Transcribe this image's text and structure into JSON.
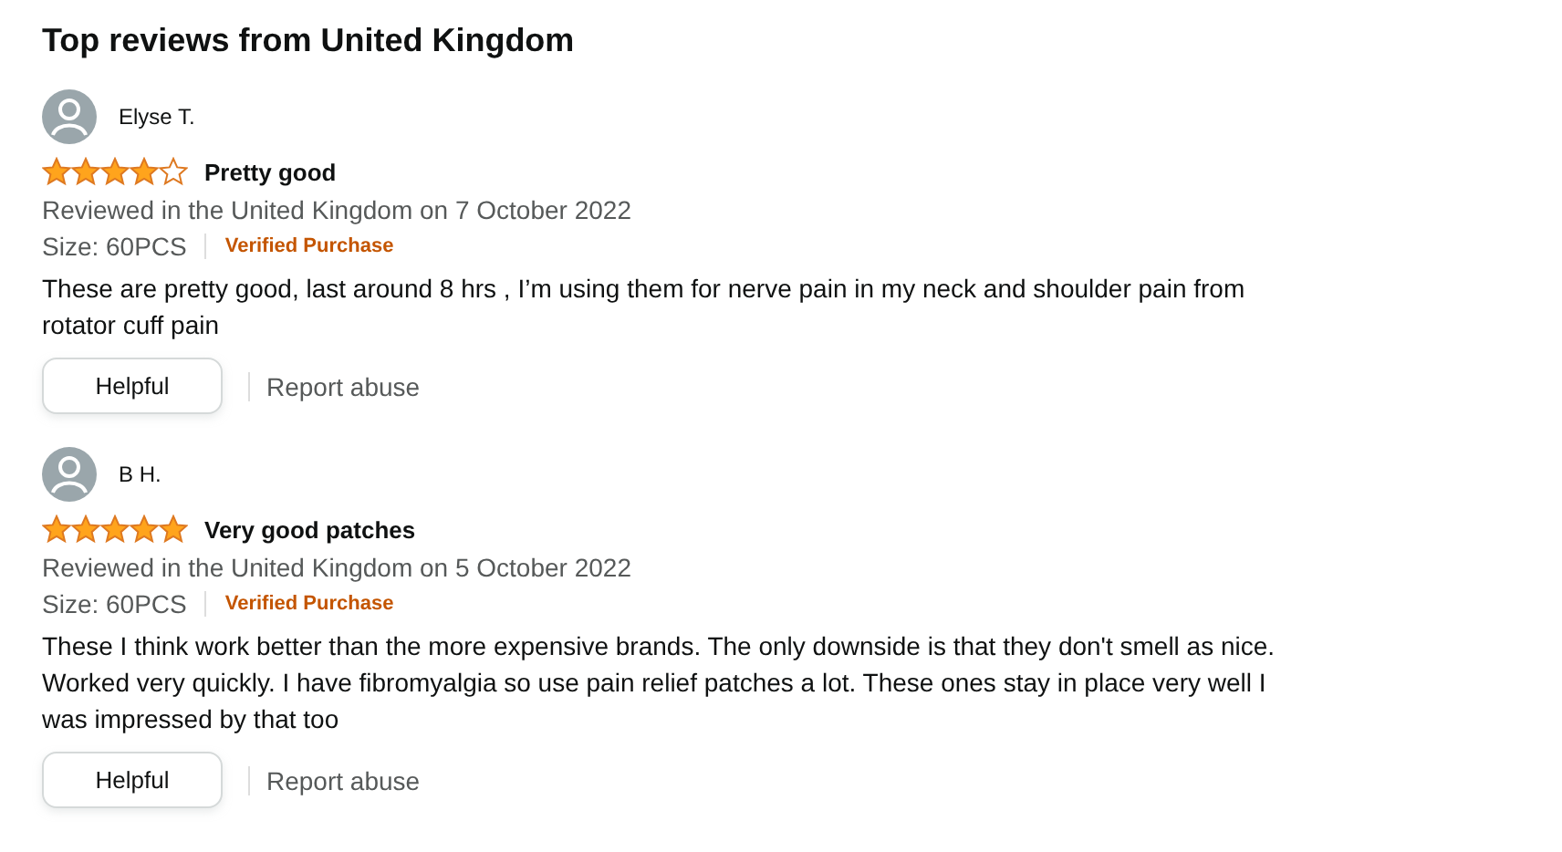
{
  "heading": "Top reviews from United Kingdom",
  "reviews": [
    {
      "author": "Elyse T.",
      "stars": 4,
      "title": "Pretty good",
      "meta": "Reviewed in the United Kingdom on 7 October 2022",
      "size": "Size: 60PCS",
      "verified": "Verified Purchase",
      "text": "These are pretty good, last around 8 hrs , I’m using them for nerve pain in my neck and shoulder pain from rotator cuff pain",
      "helpful": "Helpful",
      "report": "Report abuse"
    },
    {
      "author": "B H.",
      "stars": 5,
      "title": "Very good patches",
      "meta": "Reviewed in the United Kingdom on 5 October 2022",
      "size": "Size: 60PCS",
      "verified": "Verified Purchase",
      "text": "These I think work better than the more expensive brands. The only downside is that they don't smell as nice. Worked very quickly. I have fibromyalgia so use pain relief patches a lot. These ones stay in place very well I was impressed by that too",
      "helpful": "Helpful",
      "report": "Report abuse"
    }
  ]
}
